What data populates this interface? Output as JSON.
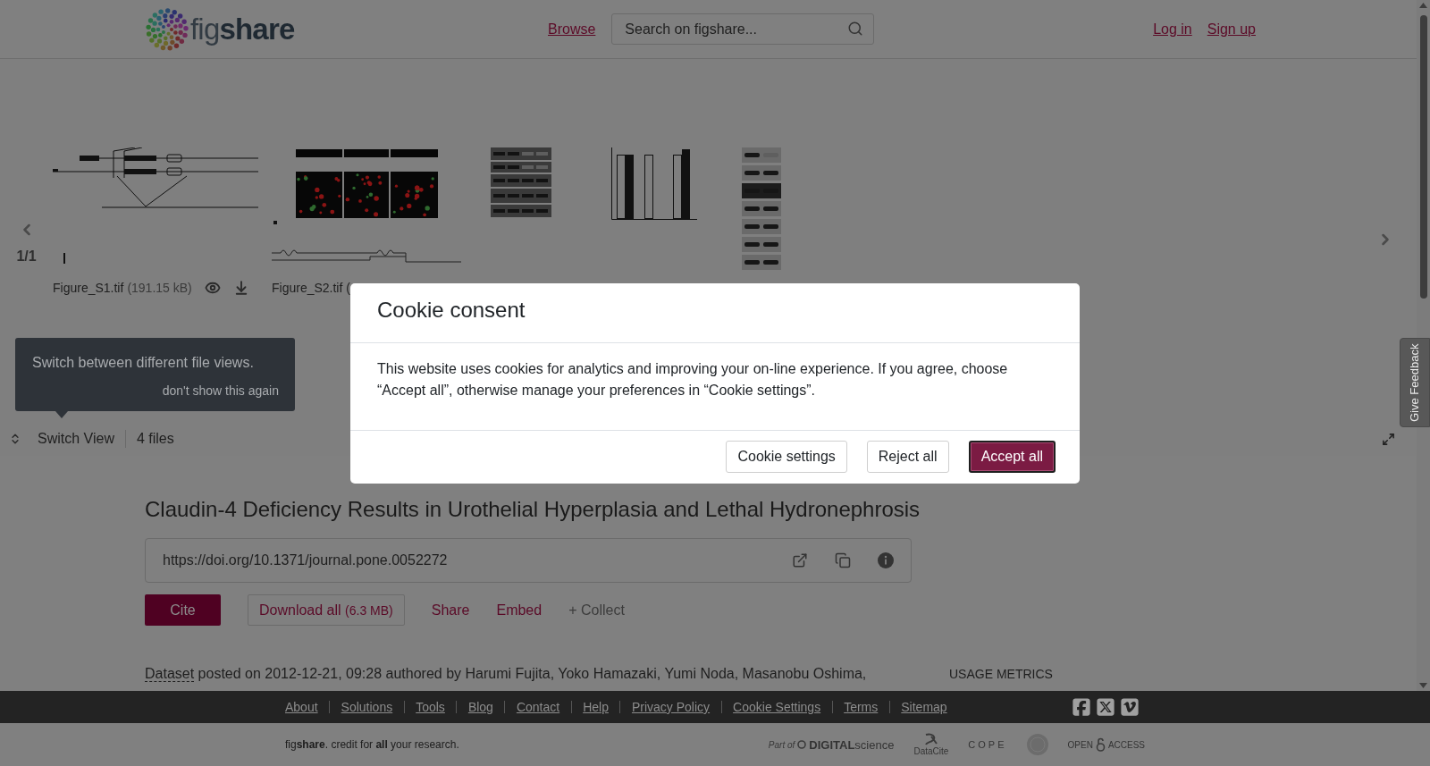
{
  "header": {
    "logo": "fig**share**",
    "nav_link": "Browse",
    "search": {
      "placeholder": "Search on figshare..."
    },
    "account_links": [
      "Log in",
      "Sign up"
    ]
  },
  "file_viewer": {
    "page_indicator": "1/1",
    "files": [
      {
        "kind": "diagram",
        "name": "Figure_S1.tif",
        "size": "(191.15 kB)"
      },
      {
        "kind": "micrograph",
        "name": "Figure_S2.tif ("
      },
      {
        "kind": "blot_chart"
      },
      {
        "kind": "blot"
      }
    ],
    "tooltip": {
      "text": "Switch between different file views.",
      "dismiss": "don't show this again"
    },
    "switch_view": "Switch View",
    "file_count": "4 files"
  },
  "article": {
    "title": "Claudin-4 Deficiency Results in Urothelial Hyperplasia and Lethal Hydronephrosis",
    "doi": "https://doi.org/10.1371/journal.pone.0052272",
    "actions": [
      {
        "kind": "cite",
        "label": "Cite"
      },
      {
        "kind": "download",
        "label": "Download all",
        "size": "(6.3 MB)"
      },
      {
        "kind": "share",
        "label": "Share"
      },
      {
        "kind": "embed",
        "label": "Embed"
      },
      {
        "kind": "collect",
        "label": "+ Collect"
      }
    ],
    "meta": {
      "type": "Dataset",
      "text": "posted on 2012-12-21, 09:28 authored by Harumi Fujita, Yoko Hamazaki, Yumi Noda, Masanobu Oshima,"
    },
    "sidebar_heading": "USAGE METRICS"
  },
  "feedback_tab": "Give Feedback",
  "cookie_dialog": {
    "title": "Cookie consent",
    "body": "This website uses cookies for analytics and improving your on-line experience. If you agree, choose “Accept all”, otherwise manage your preferences in “Cookie settings”.",
    "buttons": [
      {
        "label": "Cookie settings",
        "kind": "secondary",
        "focused": false
      },
      {
        "label": "Reject all",
        "kind": "secondary",
        "focused": false
      },
      {
        "label": "Accept all",
        "kind": "primary",
        "focused": true
      }
    ]
  },
  "footer": {
    "links": [
      "About",
      "Solutions",
      "Tools",
      "Blog",
      "Contact",
      "Help",
      "Privacy Policy",
      "Cookie Settings",
      "Terms",
      "Sitemap"
    ],
    "tagline": "fig**share**. credit for **all** your research.",
    "partners": [
      {
        "kind": "digital_science",
        "prefix": "Part of",
        "name": "**DIGITAL**science"
      },
      {
        "kind": "datacite",
        "name": "DataCite"
      },
      {
        "kind": "cope",
        "name": "COPE"
      },
      {
        "kind": "seal"
      },
      {
        "kind": "open_access",
        "name": "OPEN",
        "name2": "ACCESS"
      }
    ]
  }
}
